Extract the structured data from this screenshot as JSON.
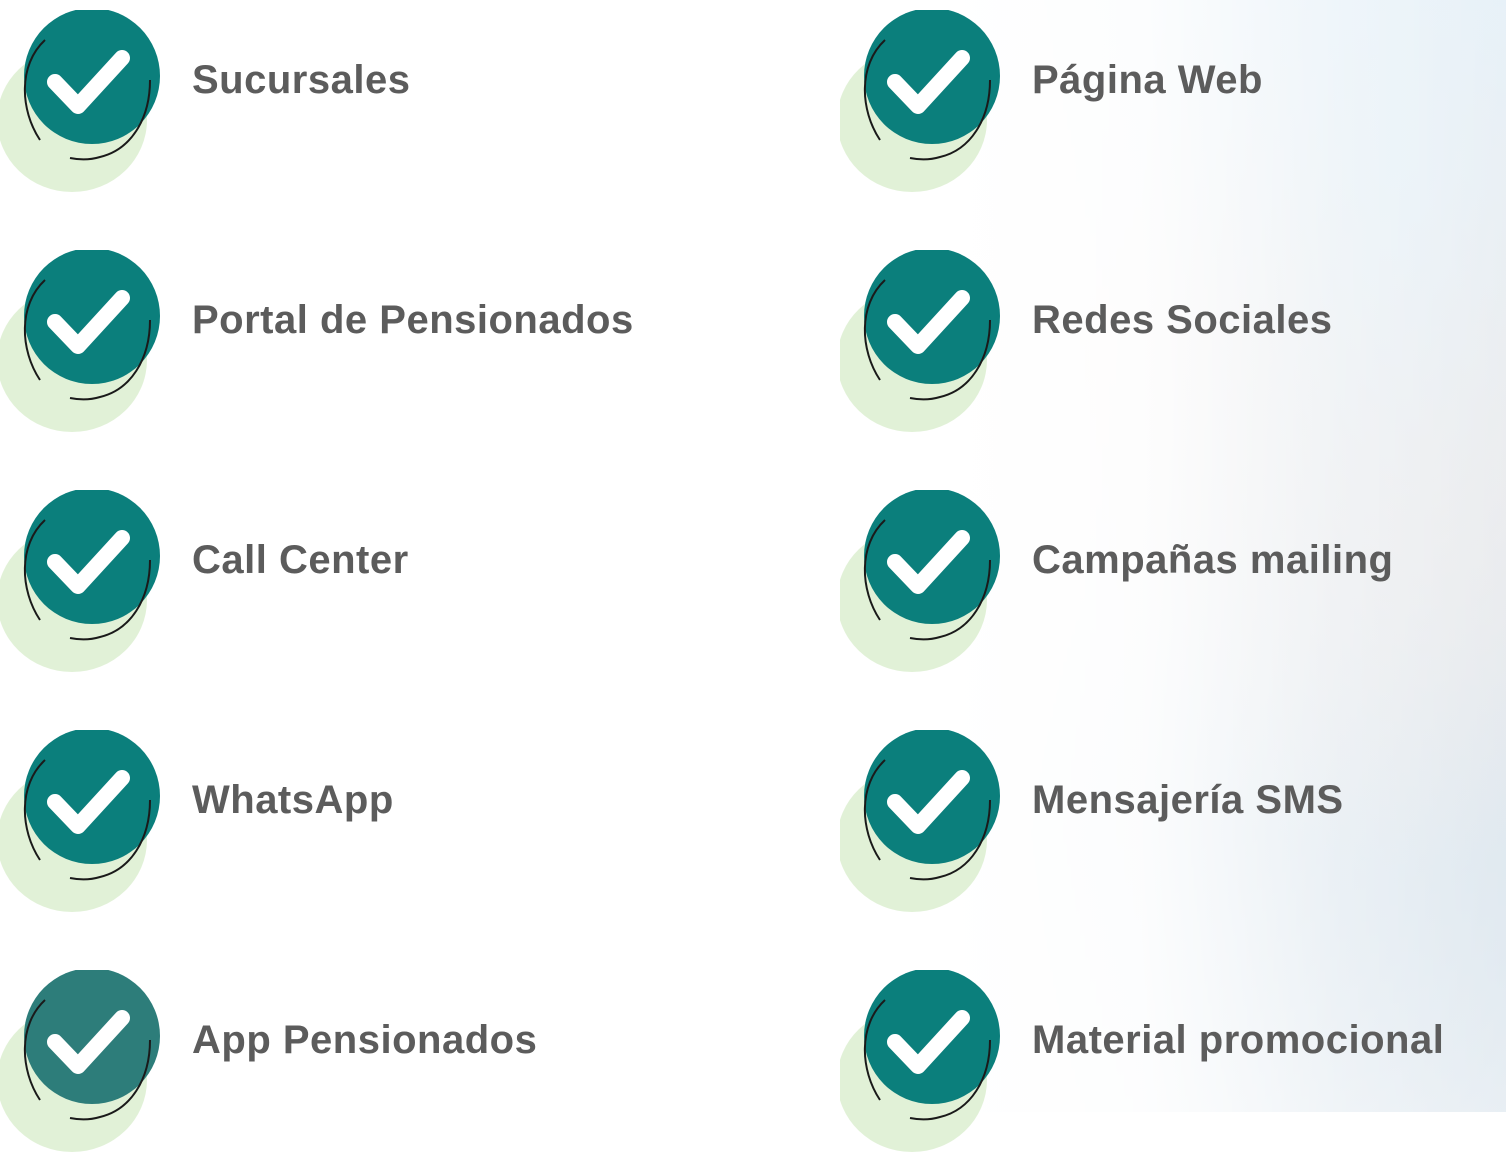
{
  "items_left": [
    {
      "label": "Sucursales",
      "icon": "check-circle-icon"
    },
    {
      "label": "Portal de Pensionados",
      "icon": "check-circle-icon"
    },
    {
      "label": "Call Center",
      "icon": "check-circle-icon"
    },
    {
      "label": "WhatsApp",
      "icon": "check-circle-icon"
    },
    {
      "label": "App Pensionados",
      "icon": "check-circle-icon"
    }
  ],
  "items_right": [
    {
      "label": "Página Web",
      "icon": "check-circle-icon"
    },
    {
      "label": "Redes Sociales",
      "icon": "check-circle-icon"
    },
    {
      "label": "Campañas mailing",
      "icon": "check-circle-icon"
    },
    {
      "label": "Mensajería SMS",
      "icon": "check-circle-icon"
    },
    {
      "label": "Material promocional",
      "icon": "check-circle-icon"
    }
  ],
  "colors": {
    "badge_fill": "#0b7f7c",
    "badge_fill_faded": "#2d7d7a",
    "badge_shadow": "#dcefd0",
    "check": "#ffffff",
    "outline": "#1a1a1a",
    "text": "#5c5c5c"
  }
}
